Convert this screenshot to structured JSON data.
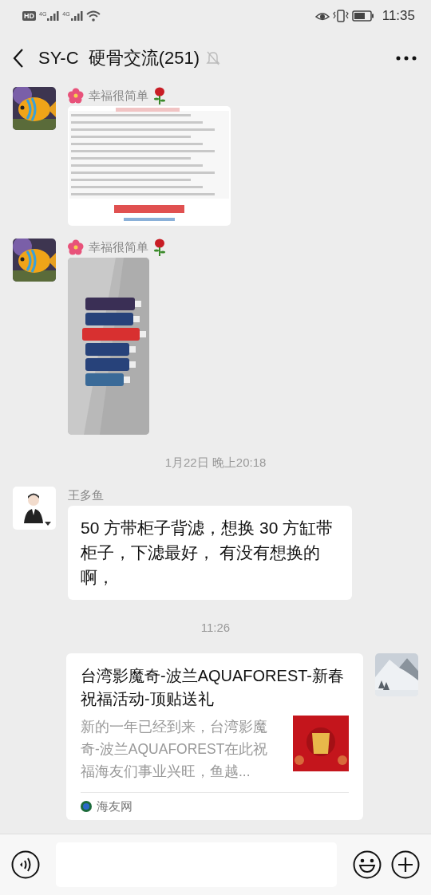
{
  "status_bar": {
    "hd": "HD",
    "networks": [
      "4G",
      "4G"
    ],
    "time": "11:35"
  },
  "header": {
    "title": "SY-C  硬骨交流(251)",
    "muted": true
  },
  "messages": [
    {
      "kind": "document_image",
      "sender": "幸福很简单",
      "decorated": true
    },
    {
      "sender": "幸福很简单",
      "decorated": true
    },
    {
      "kind": "timestamp",
      "text": "1月22日 晚上20:18"
    },
    {
      "kind": "text",
      "sender": "王多鱼",
      "text": "50 方带柜子背滤，想换 30 方缸带柜子，下滤最好， 有没有想换的啊，"
    },
    {
      "kind": "timestamp",
      "text": "11:26"
    },
    {
      "kind": "link",
      "title": "台湾影魔奇-波兰AQUAFOREST-新春祝福活动-顶贴送礼",
      "summary": "新的一年已经到来，台湾影魔奇-波兰AQUAFOREST在此祝福海友们事业兴旺，鱼越...",
      "source": "海友网"
    }
  ]
}
